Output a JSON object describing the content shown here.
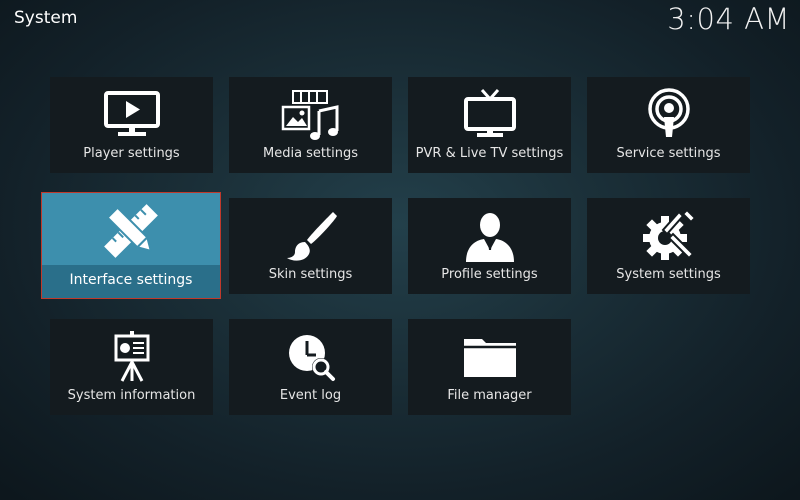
{
  "header": {
    "title": "System",
    "clock": "3:04 AM"
  },
  "tiles": [
    {
      "label": "Player settings",
      "icon": "tv-play-icon"
    },
    {
      "label": "Media settings",
      "icon": "media-icon"
    },
    {
      "label": "PVR & Live TV settings",
      "icon": "tv-icon"
    },
    {
      "label": "Service settings",
      "icon": "podcast-icon"
    },
    {
      "label": "Interface settings",
      "icon": "pencil-ruler-icon",
      "focused": true
    },
    {
      "label": "Skin settings",
      "icon": "paintbrush-icon"
    },
    {
      "label": "Profile settings",
      "icon": "profile-icon"
    },
    {
      "label": "System settings",
      "icon": "gear-tools-icon"
    },
    {
      "label": "System information",
      "icon": "presentation-icon"
    },
    {
      "label": "Event log",
      "icon": "clock-search-icon"
    },
    {
      "label": "File manager",
      "icon": "folder-icon"
    }
  ],
  "colors": {
    "focus_fill": "#3d8fad",
    "focus_border": "#c0392b",
    "tile_bg": "#141b1f"
  }
}
